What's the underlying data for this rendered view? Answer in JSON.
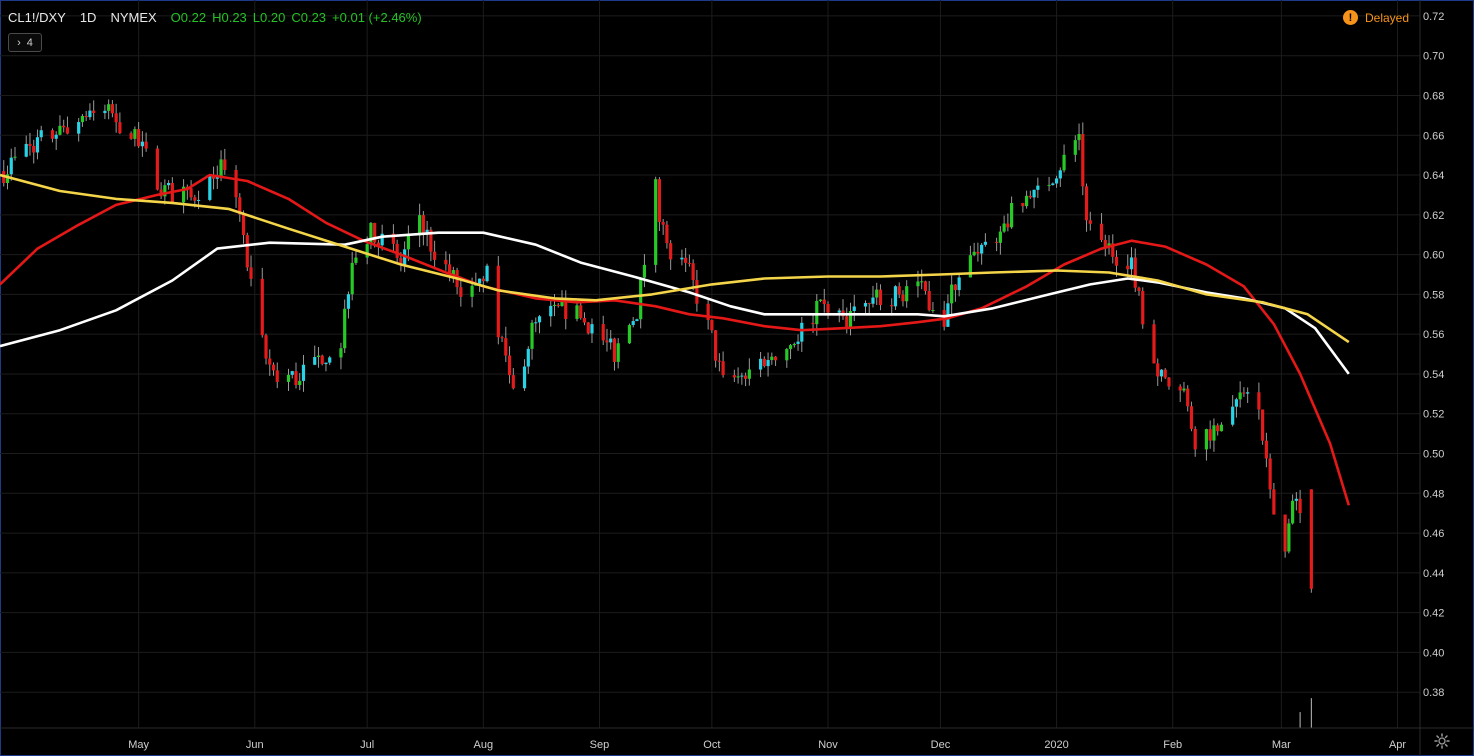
{
  "legend": {
    "symbol": "CL1!/DXY",
    "interval": "1D",
    "exchange": "NYMEX",
    "open": "O0.22",
    "high": "H0.23",
    "low": "L0.20",
    "close": "C0.23",
    "change": "+0.01 (+2.46%)"
  },
  "indicator_toggle": {
    "count": "4"
  },
  "status": {
    "delayed_label": "Delayed"
  },
  "colors": {
    "up_green": "#27c927",
    "up_cyan": "#29d3e6",
    "down": "#e41b1b",
    "ma_red": "#e51818",
    "ma_yellow": "#f4d54a",
    "ma_white": "#ffffff",
    "grid": "#1c1c1c",
    "delayed": "#f7931a"
  },
  "chart_data": {
    "type": "candlestick",
    "y_ticks": [
      "0.72",
      "0.70",
      "0.68",
      "0.66",
      "0.64",
      "0.62",
      "0.60",
      "0.58",
      "0.56",
      "0.54",
      "0.52",
      "0.50",
      "0.48",
      "0.46",
      "0.44",
      "0.42",
      "0.40",
      "0.38"
    ],
    "ylim": [
      0.362,
      0.728
    ],
    "x_labels": [
      "May",
      "Jun",
      "Jul",
      "Aug",
      "Sep",
      "Oct",
      "Nov",
      "Dec",
      "2020",
      "Feb",
      "Mar",
      "Apr"
    ],
    "x_label_dates": [
      "2019-05-01",
      "2019-06-01",
      "2019-07-01",
      "2019-08-01",
      "2019-09-01",
      "2019-10-01",
      "2019-11-01",
      "2019-12-01",
      "2020-01-01",
      "2020-02-01",
      "2020-03-01",
      "2020-04-01"
    ],
    "xlim_dates": [
      "2019-03-25",
      "2020-04-07"
    ],
    "last_bar_date": "2020-03-09",
    "price_anchors": [
      [
        "2019-03-26",
        0.642
      ],
      [
        "2019-04-02",
        0.655
      ],
      [
        "2019-04-10",
        0.662
      ],
      [
        "2019-04-18",
        0.672
      ],
      [
        "2019-04-24",
        0.67
      ],
      [
        "2019-05-01",
        0.655
      ],
      [
        "2019-05-08",
        0.632
      ],
      [
        "2019-05-15",
        0.628
      ],
      [
        "2019-05-22",
        0.645
      ],
      [
        "2019-05-27",
        0.632
      ],
      [
        "2019-05-31",
        0.582
      ],
      [
        "2019-06-04",
        0.546
      ],
      [
        "2019-06-07",
        0.54
      ],
      [
        "2019-06-12",
        0.538
      ],
      [
        "2019-06-18",
        0.548
      ],
      [
        "2019-06-24",
        0.556
      ],
      [
        "2019-06-27",
        0.6
      ],
      [
        "2019-07-03",
        0.612
      ],
      [
        "2019-07-10",
        0.595
      ],
      [
        "2019-07-15",
        0.62
      ],
      [
        "2019-07-18",
        0.605
      ],
      [
        "2019-07-26",
        0.582
      ],
      [
        "2019-08-02",
        0.592
      ],
      [
        "2019-08-06",
        0.555
      ],
      [
        "2019-08-09",
        0.53
      ],
      [
        "2019-08-14",
        0.562
      ],
      [
        "2019-08-20",
        0.572
      ],
      [
        "2019-08-28",
        0.568
      ],
      [
        "2019-09-05",
        0.55
      ],
      [
        "2019-09-11",
        0.572
      ],
      [
        "2019-09-16",
        0.632
      ],
      [
        "2019-09-19",
        0.602
      ],
      [
        "2019-09-25",
        0.59
      ],
      [
        "2019-10-01",
        0.558
      ],
      [
        "2019-10-04",
        0.535
      ],
      [
        "2019-10-10",
        0.54
      ],
      [
        "2019-10-15",
        0.548
      ],
      [
        "2019-10-22",
        0.555
      ],
      [
        "2019-10-29",
        0.572
      ],
      [
        "2019-11-05",
        0.568
      ],
      [
        "2019-11-12",
        0.576
      ],
      [
        "2019-11-19",
        0.58
      ],
      [
        "2019-11-25",
        0.585
      ],
      [
        "2019-12-02",
        0.568
      ],
      [
        "2019-12-05",
        0.586
      ],
      [
        "2019-12-10",
        0.6
      ],
      [
        "2019-12-16",
        0.61
      ],
      [
        "2019-12-20",
        0.62
      ],
      [
        "2019-12-27",
        0.63
      ],
      [
        "2020-01-03",
        0.648
      ],
      [
        "2020-01-07",
        0.66
      ],
      [
        "2020-01-09",
        0.612
      ],
      [
        "2020-01-14",
        0.604
      ],
      [
        "2020-01-17",
        0.6
      ],
      [
        "2020-01-21",
        0.598
      ],
      [
        "2020-01-24",
        0.57
      ],
      [
        "2020-01-28",
        0.54
      ],
      [
        "2020-02-04",
        0.528
      ],
      [
        "2020-02-07",
        0.508
      ],
      [
        "2020-02-12",
        0.512
      ],
      [
        "2020-02-19",
        0.528
      ],
      [
        "2020-02-21",
        0.535
      ],
      [
        "2020-02-24",
        0.52
      ],
      [
        "2020-02-27",
        0.478
      ],
      [
        "2020-03-02",
        0.45
      ],
      [
        "2020-03-04",
        0.48
      ],
      [
        "2020-03-06",
        0.468
      ],
      [
        "2020-03-09",
        0.432
      ]
    ],
    "series": [
      {
        "name": "",
        "color": "#e51818",
        "points": [
          [
            "2019-03-25",
            0.585
          ],
          [
            "2019-04-04",
            0.603
          ],
          [
            "2019-04-15",
            0.615
          ],
          [
            "2019-04-25",
            0.625
          ],
          [
            "2019-05-06",
            0.63
          ],
          [
            "2019-05-14",
            0.633
          ],
          [
            "2019-05-20",
            0.64
          ],
          [
            "2019-05-30",
            0.637
          ],
          [
            "2019-06-10",
            0.628
          ],
          [
            "2019-06-20",
            0.616
          ],
          [
            "2019-06-30",
            0.607
          ],
          [
            "2019-07-10",
            0.6
          ],
          [
            "2019-07-22",
            0.591
          ],
          [
            "2019-08-01",
            0.584
          ],
          [
            "2019-08-15",
            0.578
          ],
          [
            "2019-08-26",
            0.576
          ],
          [
            "2019-09-05",
            0.577
          ],
          [
            "2019-09-16",
            0.574
          ],
          [
            "2019-09-25",
            0.57
          ],
          [
            "2019-10-04",
            0.568
          ],
          [
            "2019-10-15",
            0.564
          ],
          [
            "2019-10-25",
            0.562
          ],
          [
            "2019-11-05",
            0.563
          ],
          [
            "2019-11-15",
            0.564
          ],
          [
            "2019-11-25",
            0.566
          ],
          [
            "2019-12-03",
            0.568
          ],
          [
            "2019-12-12",
            0.573
          ],
          [
            "2019-12-24",
            0.584
          ],
          [
            "2020-01-03",
            0.595
          ],
          [
            "2020-01-13",
            0.603
          ],
          [
            "2020-01-21",
            0.607
          ],
          [
            "2020-01-30",
            0.604
          ],
          [
            "2020-02-10",
            0.595
          ],
          [
            "2020-02-20",
            0.584
          ],
          [
            "2020-02-28",
            0.565
          ],
          [
            "2020-03-06",
            0.54
          ],
          [
            "2020-03-14",
            0.505
          ],
          [
            "2020-03-19",
            0.474
          ]
        ]
      },
      {
        "name": "",
        "color": "#ffffff",
        "points": [
          [
            "2019-03-25",
            0.554
          ],
          [
            "2019-04-10",
            0.562
          ],
          [
            "2019-04-25",
            0.572
          ],
          [
            "2019-05-10",
            0.587
          ],
          [
            "2019-05-22",
            0.603
          ],
          [
            "2019-06-05",
            0.606
          ],
          [
            "2019-06-25",
            0.605
          ],
          [
            "2019-07-05",
            0.609
          ],
          [
            "2019-07-20",
            0.611
          ],
          [
            "2019-08-01",
            0.611
          ],
          [
            "2019-08-15",
            0.605
          ],
          [
            "2019-08-27",
            0.596
          ],
          [
            "2019-09-10",
            0.589
          ],
          [
            "2019-09-25",
            0.581
          ],
          [
            "2019-10-06",
            0.574
          ],
          [
            "2019-10-15",
            0.57
          ],
          [
            "2019-10-29",
            0.57
          ],
          [
            "2019-11-12",
            0.57
          ],
          [
            "2019-11-25",
            0.57
          ],
          [
            "2019-12-02",
            0.569
          ],
          [
            "2019-12-15",
            0.573
          ],
          [
            "2019-12-30",
            0.58
          ],
          [
            "2020-01-10",
            0.585
          ],
          [
            "2020-01-20",
            0.588
          ],
          [
            "2020-01-28",
            0.586
          ],
          [
            "2020-02-10",
            0.581
          ],
          [
            "2020-02-20",
            0.578
          ],
          [
            "2020-03-02",
            0.573
          ],
          [
            "2020-03-10",
            0.563
          ],
          [
            "2020-03-19",
            0.54
          ]
        ]
      },
      {
        "name": "",
        "color": "#f4d54a",
        "points": [
          [
            "2019-03-25",
            0.64
          ],
          [
            "2019-04-10",
            0.632
          ],
          [
            "2019-04-25",
            0.628
          ],
          [
            "2019-05-10",
            0.626
          ],
          [
            "2019-05-25",
            0.623
          ],
          [
            "2019-06-10",
            0.613
          ],
          [
            "2019-06-25",
            0.604
          ],
          [
            "2019-07-10",
            0.595
          ],
          [
            "2019-07-25",
            0.588
          ],
          [
            "2019-08-05",
            0.582
          ],
          [
            "2019-08-20",
            0.578
          ],
          [
            "2019-08-31",
            0.577
          ],
          [
            "2019-09-15",
            0.58
          ],
          [
            "2019-10-01",
            0.585
          ],
          [
            "2019-10-15",
            0.588
          ],
          [
            "2019-11-01",
            0.589
          ],
          [
            "2019-11-15",
            0.589
          ],
          [
            "2019-12-01",
            0.59
          ],
          [
            "2019-12-15",
            0.591
          ],
          [
            "2020-01-01",
            0.592
          ],
          [
            "2020-01-15",
            0.591
          ],
          [
            "2020-01-28",
            0.587
          ],
          [
            "2020-02-10",
            0.58
          ],
          [
            "2020-02-25",
            0.576
          ],
          [
            "2020-03-08",
            0.57
          ],
          [
            "2020-03-19",
            0.556
          ]
        ]
      }
    ],
    "final_candle": {
      "date": "2020-03-09",
      "open": 0.482,
      "high": 0.482,
      "low": 0.43,
      "close": 0.432
    },
    "volume_bars": [
      [
        "2020-03-06",
        0.37
      ],
      [
        "2020-03-09",
        0.377
      ]
    ],
    "grid": true
  }
}
